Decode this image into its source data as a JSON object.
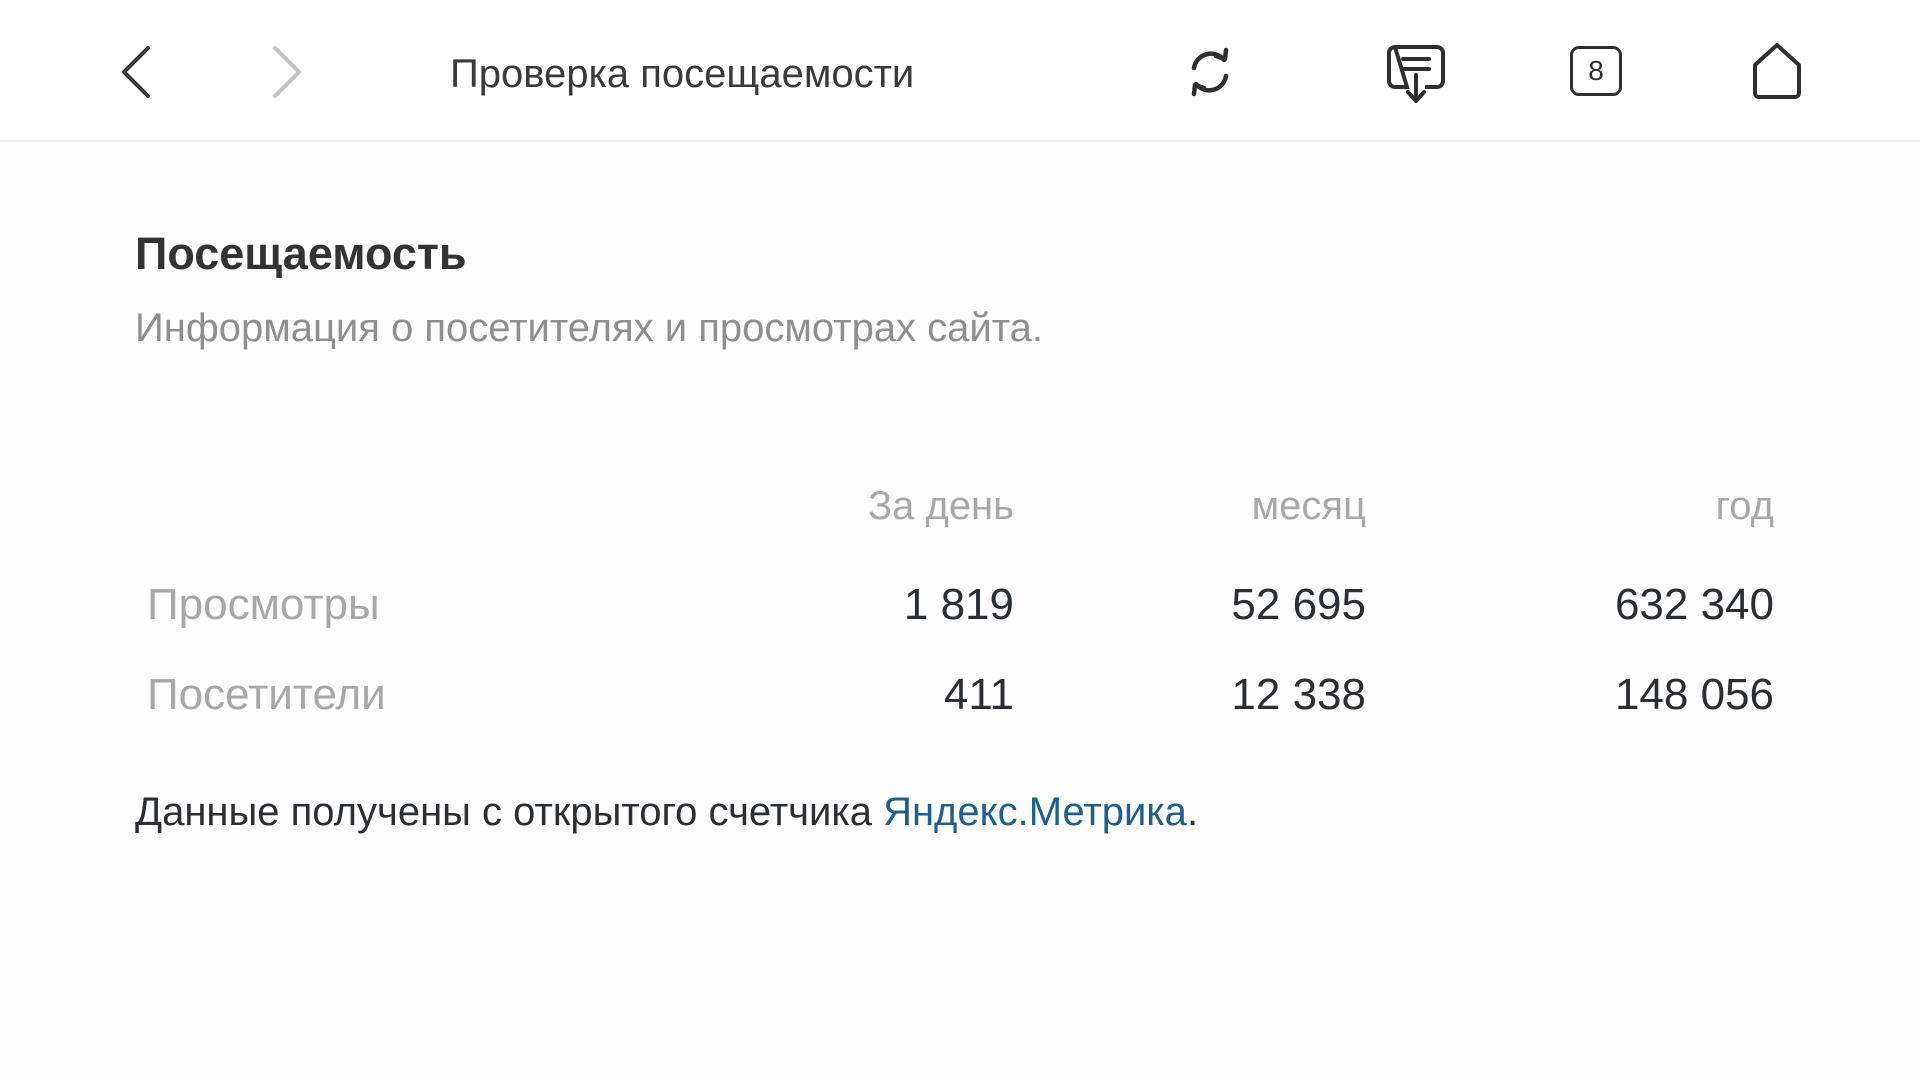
{
  "toolbar": {
    "back_icon": "chevron-left-icon",
    "forward_icon": "chevron-right-icon",
    "title": "Проверка посещаемости",
    "reload_icon": "reload-icon",
    "reader_icon": "download-message-icon",
    "tab_count": "8",
    "home_icon": "home-icon"
  },
  "main": {
    "heading": "Посещаемость",
    "subheading": "Информация о посетителях и просмотрах сайта.",
    "table": {
      "columns": [
        "За день",
        "месяц",
        "год"
      ],
      "rows": [
        {
          "label": "Просмотры",
          "values": [
            "1 819",
            "52 695",
            "632 340"
          ]
        },
        {
          "label": "Посетители",
          "values": [
            "411",
            "12 338",
            "148 056"
          ]
        }
      ]
    },
    "footnote_text": "Данные получены с открытого счетчика ",
    "footnote_link": "Яндекс.Метрика",
    "footnote_end": "."
  },
  "colors": {
    "link": "#1f5f8b",
    "muted_text": "#a8a8a8",
    "primary_text": "#2b2f33"
  }
}
